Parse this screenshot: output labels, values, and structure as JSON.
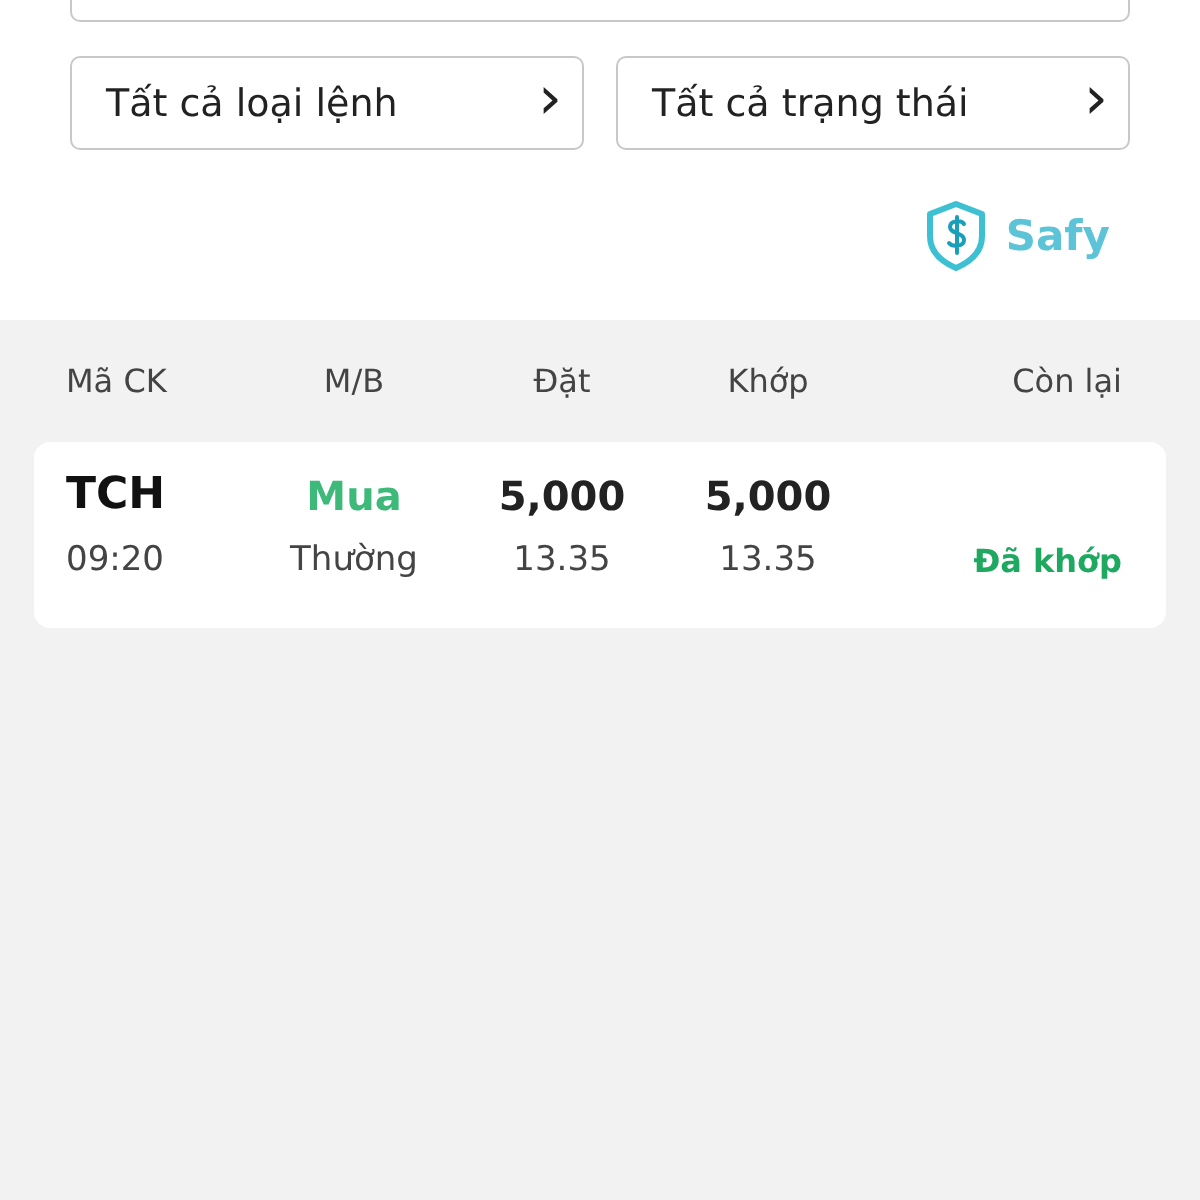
{
  "filters": [
    {
      "label": "Tất cả loại lệnh",
      "chevron": "›"
    },
    {
      "label": "Tất cả trạng thái",
      "chevron": "›"
    }
  ],
  "brand": {
    "name": "Safy"
  },
  "table": {
    "columns": [
      "Mã CK",
      "M/B",
      "Đặt",
      "Khớp",
      "Còn lại"
    ],
    "rows": [
      {
        "symbol": "TCH",
        "time": "09:20",
        "side": {
          "text": "Mua",
          "kind": "buy"
        },
        "order_type": "Thường",
        "ordered_qty": "5,000",
        "ordered_price": "13.35",
        "matched_qty": "5,000",
        "matched_price": "13.35",
        "status": {
          "text": "Đã khớp",
          "kind": "matched"
        }
      }
    ]
  }
}
